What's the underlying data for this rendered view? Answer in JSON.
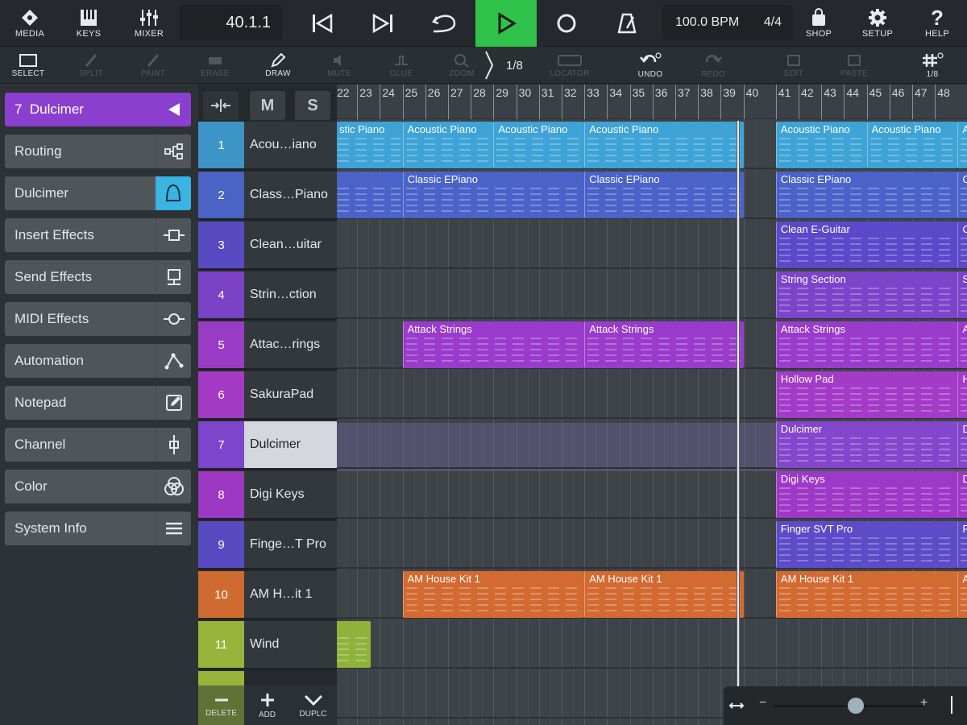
{
  "topbar": {
    "media": "MEDIA",
    "keys": "KEYS",
    "mixer": "MIXER",
    "position": "40.1.1",
    "tempo": "100.0 BPM",
    "signature": "4/4",
    "shop": "SHOP",
    "setup": "SETUP",
    "help": "HELP"
  },
  "toolbar": {
    "select": "SELECT",
    "split": "SPLIT",
    "paint": "PAINT",
    "erase": "ERASE",
    "draw": "DRAW",
    "mute": "MUTE",
    "glue": "GLUE",
    "zoom": "ZOOM",
    "quantize": "1/8",
    "locator": "LOCATOR",
    "undo": "UNDO",
    "redo": "REDO",
    "edit": "EDIT",
    "paste": "PASTE",
    "grid": "1/8"
  },
  "inspector": {
    "title": "7  Dulcimer",
    "items": [
      {
        "label": "Routing",
        "icon": "routing-icon"
      },
      {
        "label": "Dulcimer",
        "icon": "instrument-icon"
      },
      {
        "label": "Insert Effects",
        "icon": "insert-effects-icon"
      },
      {
        "label": "Send Effects",
        "icon": "send-effects-icon"
      },
      {
        "label": "MIDI Effects",
        "icon": "midi-effects-icon"
      },
      {
        "label": "Automation",
        "icon": "automation-icon"
      },
      {
        "label": "Notepad",
        "icon": "notepad-icon"
      },
      {
        "label": "Channel",
        "icon": "channel-icon"
      },
      {
        "label": "Color",
        "icon": "color-icon"
      },
      {
        "label": "System Info",
        "icon": "menu-icon"
      }
    ]
  },
  "tracklist": {
    "mute": "M",
    "solo": "S",
    "tracks": [
      {
        "num": "1",
        "name": "Acou…iano",
        "color": "#3d95c6"
      },
      {
        "num": "2",
        "name": "Class…Piano",
        "color": "#4a63c4"
      },
      {
        "num": "3",
        "name": "Clean…uitar",
        "color": "#5a4ac2"
      },
      {
        "num": "4",
        "name": "Strin…ction",
        "color": "#7a42c4"
      },
      {
        "num": "5",
        "name": "Attac…rings",
        "color": "#9a3bc6"
      },
      {
        "num": "6",
        "name": "SakuraPad",
        "color": "#a53ac4"
      },
      {
        "num": "7",
        "name": "Dulcimer",
        "color": "#7c45cc"
      },
      {
        "num": "8",
        "name": "Digi Keys",
        "color": "#9c38c2"
      },
      {
        "num": "9",
        "name": "Finge…T Pro",
        "color": "#5a4ac2"
      },
      {
        "num": "10",
        "name": "AM H…it 1",
        "color": "#cf6b30"
      },
      {
        "num": "11",
        "name": "Wind",
        "color": "#98b43a"
      }
    ],
    "delete": "DELETE",
    "add": "ADD",
    "duplicate": "DUPLC"
  },
  "ruler": {
    "bars": [
      "22",
      "23",
      "24",
      "25",
      "26",
      "27",
      "28",
      "29",
      "30",
      "31",
      "32",
      "33",
      "34",
      "35",
      "36",
      "37",
      "38",
      "39",
      "40",
      "41",
      "42",
      "43",
      "44",
      "45",
      "46",
      "47",
      "48"
    ]
  },
  "clips": [
    {
      "lane": 0,
      "label": "stic Piano",
      "color": "#3ea3d6",
      "start": 22.0,
      "end": 25.0
    },
    {
      "lane": 0,
      "label": "Acoustic Piano",
      "color": "#3ea3d6",
      "start": 25.0,
      "end": 29.0
    },
    {
      "lane": 0,
      "label": "Acoustic Piano",
      "color": "#3ea3d6",
      "start": 29.0,
      "end": 33.0
    },
    {
      "lane": 0,
      "label": "Acoustic Piano",
      "color": "#3ea3d6",
      "start": 33.0,
      "end": 40.0
    },
    {
      "lane": 0,
      "label": "Acoustic Piano",
      "color": "#3ea3d6",
      "start": 41.0,
      "end": 45.0
    },
    {
      "lane": 0,
      "label": "Acoustic Piano",
      "color": "#3ea3d6",
      "start": 45.0,
      "end": 49.0
    },
    {
      "lane": 0,
      "label": "Aco",
      "color": "#3ea3d6",
      "start": 49.0,
      "end": 51.0
    },
    {
      "lane": 1,
      "label": "",
      "color": "#4b63c9",
      "start": 22.0,
      "end": 25.0
    },
    {
      "lane": 1,
      "label": "Classic EPiano",
      "color": "#4b63c9",
      "start": 25.0,
      "end": 33.0
    },
    {
      "lane": 1,
      "label": "Classic EPiano",
      "color": "#4b63c9",
      "start": 33.0,
      "end": 40.0
    },
    {
      "lane": 1,
      "label": "Classic EPiano",
      "color": "#4b63c9",
      "start": 41.0,
      "end": 49.0
    },
    {
      "lane": 1,
      "label": "Clas",
      "color": "#4b63c9",
      "start": 49.0,
      "end": 51.0
    },
    {
      "lane": 2,
      "label": "Clean E-Guitar",
      "color": "#5b49c9",
      "start": 41.0,
      "end": 49.0
    },
    {
      "lane": 2,
      "label": "Clea",
      "color": "#5b49c9",
      "start": 49.0,
      "end": 51.0
    },
    {
      "lane": 3,
      "label": "String Section",
      "color": "#7c44ca",
      "start": 41.0,
      "end": 49.0
    },
    {
      "lane": 3,
      "label": "Strin",
      "color": "#7c44ca",
      "start": 49.0,
      "end": 51.0
    },
    {
      "lane": 4,
      "label": "Attack Strings",
      "color": "#9a3bcc",
      "start": 25.0,
      "end": 33.0
    },
    {
      "lane": 4,
      "label": "Attack Strings",
      "color": "#9a3bcc",
      "start": 33.0,
      "end": 40.0
    },
    {
      "lane": 4,
      "label": "Attack Strings",
      "color": "#9a3bcc",
      "start": 41.0,
      "end": 49.0
    },
    {
      "lane": 4,
      "label": "Atta",
      "color": "#9a3bcc",
      "start": 49.0,
      "end": 51.0
    },
    {
      "lane": 5,
      "label": "Hollow Pad",
      "color": "#a33ac8",
      "start": 41.0,
      "end": 49.0
    },
    {
      "lane": 5,
      "label": "Hollo",
      "color": "#a33ac8",
      "start": 49.0,
      "end": 51.0
    },
    {
      "lane": 6,
      "label": "Dulcimer",
      "color": "#8446cc",
      "start": 41.0,
      "end": 49.0
    },
    {
      "lane": 6,
      "label": "Dulc",
      "color": "#8446cc",
      "start": 49.0,
      "end": 51.0
    },
    {
      "lane": 7,
      "label": "Digi Keys",
      "color": "#9e38c6",
      "start": 41.0,
      "end": 49.0
    },
    {
      "lane": 7,
      "label": "Digi",
      "color": "#9e38c6",
      "start": 49.0,
      "end": 51.0
    },
    {
      "lane": 8,
      "label": "Finger SVT Pro",
      "color": "#5e4bc8",
      "start": 41.0,
      "end": 49.0
    },
    {
      "lane": 8,
      "label": "Fing",
      "color": "#5e4bc8",
      "start": 49.0,
      "end": 51.0
    },
    {
      "lane": 9,
      "label": "AM House Kit 1",
      "color": "#d26a32",
      "start": 25.0,
      "end": 33.0
    },
    {
      "lane": 9,
      "label": "AM House Kit 1",
      "color": "#d26a32",
      "start": 33.0,
      "end": 40.0
    },
    {
      "lane": 9,
      "label": "AM House Kit 1",
      "color": "#d26a32",
      "start": 41.0,
      "end": 49.0
    },
    {
      "lane": 9,
      "label": "AM",
      "color": "#d26a32",
      "start": 49.0,
      "end": 51.0
    },
    {
      "lane": 10,
      "label": "",
      "color": "#8fb23a",
      "start": 22.0,
      "end": 23.6
    }
  ],
  "colors": {
    "accent_green": "#2fc14a",
    "selected_purple": "#8b3fce",
    "active_blue": "#39b4e3"
  },
  "zoom": {
    "level": 0.55
  }
}
